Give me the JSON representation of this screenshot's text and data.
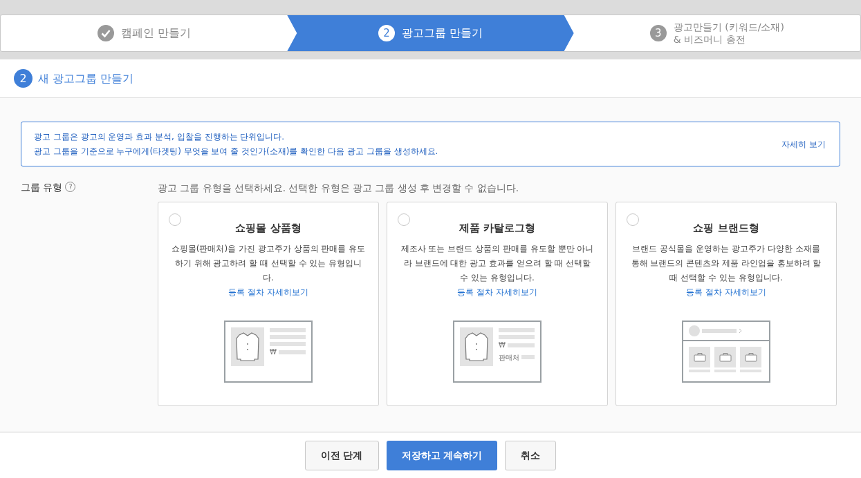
{
  "steps": [
    {
      "kind": "done",
      "lines": [
        "캠페인 만들기"
      ],
      "selected": false
    },
    {
      "kind": "number",
      "number": "2",
      "lines": [
        "광고그룹 만들기"
      ],
      "selected": true
    },
    {
      "kind": "number",
      "number": "3",
      "lines": [
        "광고만들기 (키워드/소재)",
        "& 비즈머니 충전"
      ],
      "selected": false
    }
  ],
  "section": {
    "number": "2",
    "title": "새 광고그룹 만들기"
  },
  "info": {
    "lines": [
      "광고 그룹은 광고의 운영과 효과 분석, 입찰을 진행하는 단위입니다.",
      "광고 그룹을 기준으로 누구에게(타겟팅) 무엇을 보여 줄 것인가(소재)를 확인한 다음 광고 그룹을 생성하세요."
    ],
    "link": "자세히 보기"
  },
  "group_type": {
    "label": "그룹 유형",
    "help": "?",
    "instruction": "광고 그룹 유형을 선택하세요. 선택한 유형은 광고 그룹 생성 후 변경할 수 없습니다.",
    "options": [
      {
        "title": "쇼핑몰 상품형",
        "description": "쇼핑몰(판매처)을 가진 광고주가 상품의 판매를 유도하기 위해 광고하려 할 때 선택할 수 있는 유형입니다.",
        "link": "등록 절차 자세히보기",
        "selected": false,
        "illustration": {
          "kind": "product",
          "currency": "₩"
        }
      },
      {
        "title": "제품 카탈로그형",
        "description": "제조사 또는 브랜드 상품의 판매를 유도할 뿐만 아니라 브랜드에 대한 광고 효과를 얻으려 할 때 선택할 수 있는 유형입니다.",
        "link": "등록 절차 자세히보기",
        "selected": false,
        "illustration": {
          "kind": "catalog",
          "currency": "₩",
          "seller": "판매처"
        }
      },
      {
        "title": "쇼핑 브랜드형",
        "description": "브랜드 공식몰을 운영하는 광고주가 다양한 소재를 통해 브랜드의 콘텐츠와 제품 라인업을 홍보하려 할 때 선택할 수 있는 유형입니다.",
        "link": "등록 절차 자세히보기",
        "selected": false,
        "illustration": {
          "kind": "brand"
        }
      }
    ]
  },
  "buttons": [
    {
      "label": "이전 단계",
      "kind": "secondary"
    },
    {
      "label": "저장하고 계속하기",
      "kind": "primary"
    },
    {
      "label": "취소",
      "kind": "secondary"
    }
  ]
}
